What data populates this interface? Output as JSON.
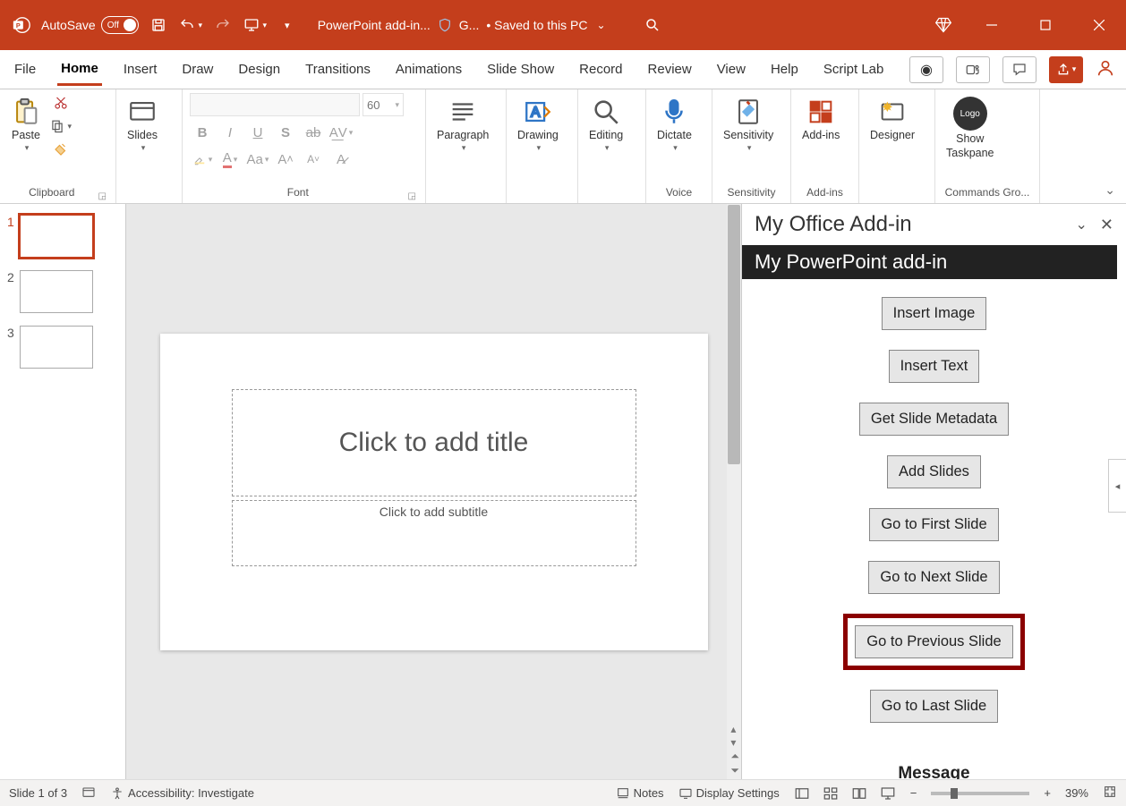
{
  "title_bar": {
    "autosave_label": "AutoSave",
    "autosave_state": "Off",
    "doc_title": "PowerPoint add-in...",
    "shield_text": "G...",
    "save_status": "• Saved to this PC"
  },
  "tabs": {
    "items": [
      "File",
      "Home",
      "Insert",
      "Draw",
      "Design",
      "Transitions",
      "Animations",
      "Slide Show",
      "Record",
      "Review",
      "View",
      "Help",
      "Script Lab"
    ],
    "active": "Home"
  },
  "ribbon": {
    "clipboard": {
      "paste": "Paste",
      "label": "Clipboard"
    },
    "slides": {
      "slides": "Slides"
    },
    "font": {
      "size": "60",
      "label": "Font"
    },
    "paragraph": {
      "label": "Paragraph"
    },
    "drawing": {
      "label": "Drawing"
    },
    "editing": {
      "label": "Editing"
    },
    "voice": {
      "dictate": "Dictate",
      "label": "Voice"
    },
    "sensitivity": {
      "btn": "Sensitivity",
      "label": "Sensitivity"
    },
    "addins": {
      "btn": "Add-ins",
      "label": "Add-ins"
    },
    "designer": {
      "btn": "Designer"
    },
    "taskpane": {
      "btn_l1": "Show",
      "btn_l2": "Taskpane",
      "logo": "Logo"
    },
    "commands": {
      "label": "Commands Gro..."
    }
  },
  "slide": {
    "title_ph": "Click to add title",
    "sub_ph": "Click to add subtitle"
  },
  "thumbs": [
    "1",
    "2",
    "3"
  ],
  "taskpane": {
    "title": "My Office Add-in",
    "stripe": "My PowerPoint add-in",
    "buttons": [
      "Insert Image",
      "Insert Text",
      "Get Slide Metadata",
      "Add Slides",
      "Go to First Slide",
      "Go to Next Slide",
      "Go to Previous Slide",
      "Go to Last Slide"
    ],
    "highlight_index": 6,
    "message_heading": "Message"
  },
  "status": {
    "slide_info": "Slide 1 of 3",
    "a11y": "Accessibility: Investigate",
    "notes": "Notes",
    "display": "Display Settings",
    "zoom_pct": "39%"
  }
}
